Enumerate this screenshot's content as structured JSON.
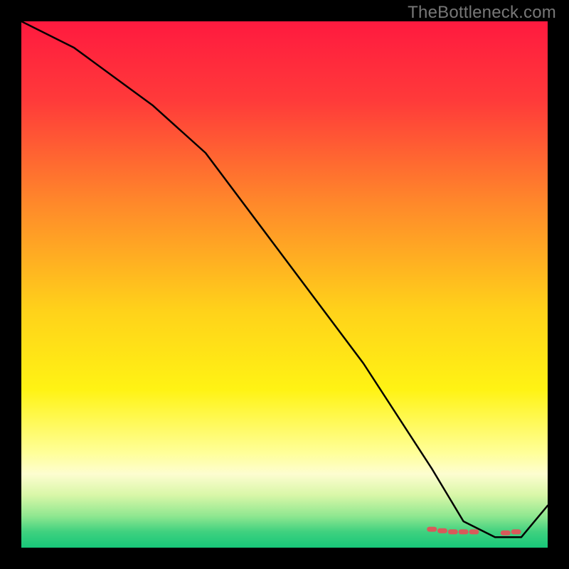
{
  "attribution": "TheBottleneck.com",
  "chart_data": {
    "type": "line",
    "title": "",
    "xlabel": "",
    "ylabel": "",
    "xlim": [
      0,
      100
    ],
    "ylim": [
      0,
      100
    ],
    "grid": false,
    "legend": false,
    "background_gradient_stops": [
      {
        "offset": 0.0,
        "color": "#ff1a3f"
      },
      {
        "offset": 0.15,
        "color": "#ff3a3a"
      },
      {
        "offset": 0.35,
        "color": "#ff8a2a"
      },
      {
        "offset": 0.55,
        "color": "#ffd21a"
      },
      {
        "offset": 0.7,
        "color": "#fff314"
      },
      {
        "offset": 0.82,
        "color": "#ffff99"
      },
      {
        "offset": 0.86,
        "color": "#fdfdd0"
      },
      {
        "offset": 0.9,
        "color": "#d9f7a8"
      },
      {
        "offset": 0.94,
        "color": "#8fe790"
      },
      {
        "offset": 0.97,
        "color": "#3fd17f"
      },
      {
        "offset": 1.0,
        "color": "#17c779"
      }
    ],
    "series": [
      {
        "name": "bottleneck-curve",
        "color": "#000000",
        "width": 2.5,
        "x": [
          0,
          10,
          25,
          35,
          50,
          65,
          78,
          84,
          90,
          95,
          100
        ],
        "y": [
          100,
          95,
          84,
          75,
          55,
          35,
          15,
          5,
          2,
          2,
          8
        ]
      }
    ],
    "markers": {
      "name": "optimal-range",
      "color": "#d85a5a",
      "shape": "rounded-dash",
      "x": [
        78,
        80,
        82,
        84,
        86,
        92,
        94
      ],
      "y": [
        3.5,
        3.2,
        3.0,
        3.0,
        3.0,
        2.8,
        3.0
      ]
    }
  }
}
